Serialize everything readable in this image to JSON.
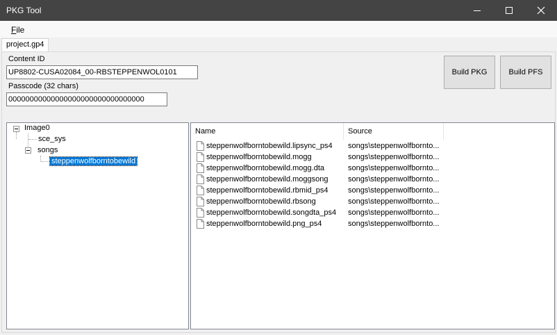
{
  "window": {
    "title": "PKG Tool"
  },
  "menu": {
    "file_label": "File",
    "file_mnemonic": "F",
    "file_rest": "ile"
  },
  "tabs": [
    {
      "label": "project.gp4"
    }
  ],
  "form": {
    "content_id_label": "Content ID",
    "content_id_value": "UP8802-CUSA02084_00-RBSTEPPENWOL0101",
    "passcode_label": "Passcode (32 chars)",
    "passcode_value": "00000000000000000000000000000000"
  },
  "buttons": {
    "build_pkg": "Build PKG",
    "build_pfs": "Build PFS"
  },
  "tree": {
    "root": "Image0",
    "children": [
      {
        "label": "sce_sys"
      },
      {
        "label": "songs",
        "children": [
          {
            "label": "steppenwolfborntobewild",
            "selected": true
          }
        ]
      }
    ]
  },
  "list": {
    "columns": [
      "Name",
      "Source"
    ],
    "rows": [
      {
        "name": "steppenwolfborntobewild.lipsync_ps4",
        "source": "songs\\steppenwolfbornto..."
      },
      {
        "name": "steppenwolfborntobewild.mogg",
        "source": "songs\\steppenwolfbornto..."
      },
      {
        "name": "steppenwolfborntobewild.mogg.dta",
        "source": "songs\\steppenwolfbornto..."
      },
      {
        "name": "steppenwolfborntobewild.moggsong",
        "source": "songs\\steppenwolfbornto..."
      },
      {
        "name": "steppenwolfborntobewild.rbmid_ps4",
        "source": "songs\\steppenwolfbornto..."
      },
      {
        "name": "steppenwolfborntobewild.rbsong",
        "source": "songs\\steppenwolfbornto..."
      },
      {
        "name": "steppenwolfborntobewild.songdta_ps4",
        "source": "songs\\steppenwolfbornto..."
      },
      {
        "name": "steppenwolfborntobewild.png_ps4",
        "source": "songs\\steppenwolfbornto..."
      }
    ]
  },
  "colors": {
    "titlebar": "#444444",
    "selection": "#0078d7",
    "button_face": "#e1e1e1"
  }
}
